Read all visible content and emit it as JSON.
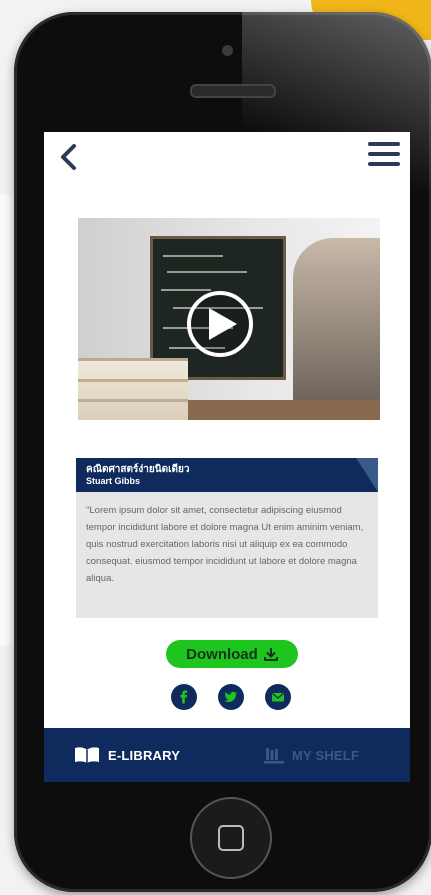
{
  "top_bar": {
    "back_icon": "chevron-left-icon",
    "menu_icon": "hamburger-menu-icon"
  },
  "video": {
    "play_icon": "play-icon"
  },
  "book": {
    "title": "คณิตศาสตร์ง่ายนิดเดียว",
    "author": "Stuart Gibbs",
    "description": "\"Lorem ipsum dolor sit amet, consectetur adipiscing eiusmod tempor incididunt labore et dolore magna Ut enim aminim veniam, quis nostrud exercitation laboris nisi ut aliquip ex ea commodo consequat. eiusmod tempor incididunt ut labore et dolore magna aliqua."
  },
  "download": {
    "label": "Download",
    "icon": "download-icon"
  },
  "share": [
    {
      "name": "facebook-icon"
    },
    {
      "name": "twitter-icon"
    },
    {
      "name": "email-icon"
    }
  ],
  "bottom_nav": {
    "library_label": "E-LIBRARY",
    "library_icon": "open-book-icon",
    "shelf_label": "MY SHELF",
    "shelf_icon": "bookshelf-icon"
  },
  "colors": {
    "navy": "#0f2a5c",
    "green": "#1ec51e",
    "accent_yellow": "#f0b519"
  }
}
